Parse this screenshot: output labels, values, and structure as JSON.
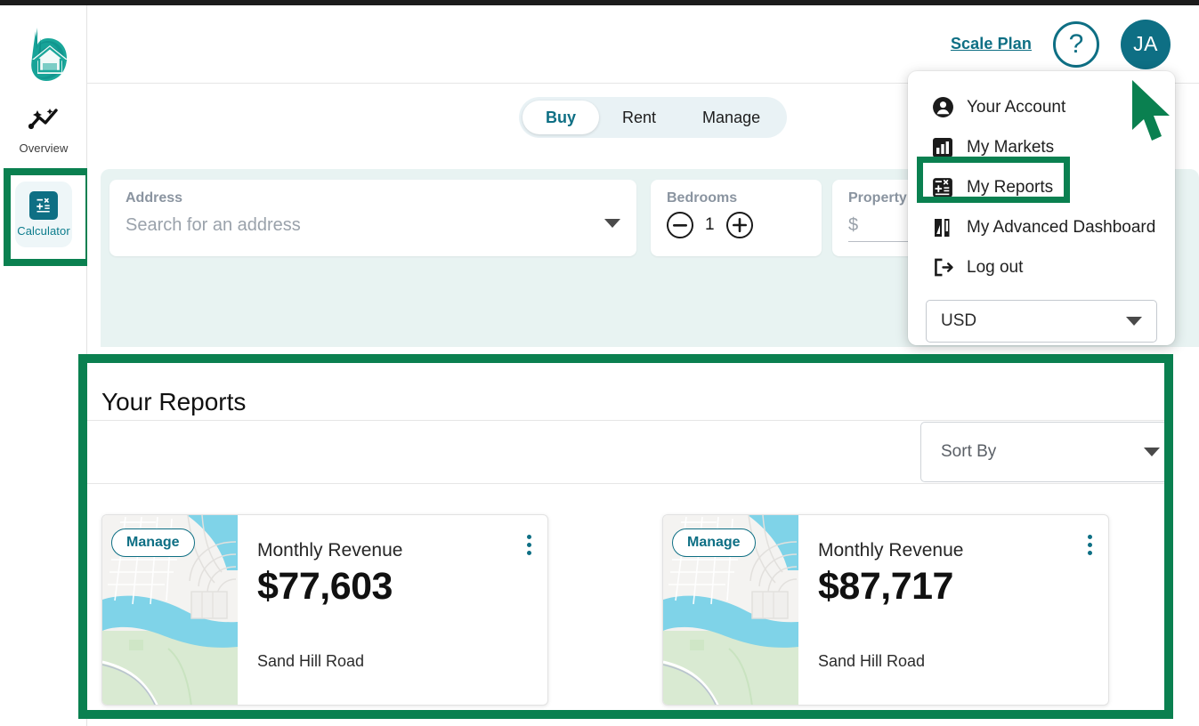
{
  "app": {
    "logo_alt": "property-logo",
    "accent_teal": "#0e6f84",
    "highlight_green": "#0a8050"
  },
  "sidebar": {
    "items": [
      {
        "label": "Overview",
        "icon": "trend-sparkle-icon",
        "active": false
      },
      {
        "label": "Calculator",
        "icon": "calculator-icon",
        "active": true
      }
    ]
  },
  "header": {
    "plan_link": "Scale Plan",
    "help_label": "?",
    "avatar_initials": "JA"
  },
  "tabs": {
    "items": [
      {
        "label": "Buy",
        "active": true
      },
      {
        "label": "Rent",
        "active": false
      },
      {
        "label": "Manage",
        "active": false
      }
    ]
  },
  "filters": {
    "address": {
      "label": "Address",
      "placeholder": "Search for an address"
    },
    "bedrooms": {
      "label": "Bedrooms",
      "value": "1",
      "minus": "−",
      "plus": "+"
    },
    "price": {
      "label": "Property P",
      "value": "$"
    }
  },
  "account_menu": {
    "items": [
      {
        "label": "Your Account",
        "icon": "person-circle-icon",
        "highlighted": false
      },
      {
        "label": "My Markets",
        "icon": "bar-chart-icon",
        "highlighted": false
      },
      {
        "label": "My Reports",
        "icon": "calculator-icon",
        "highlighted": true
      },
      {
        "label": "My Advanced Dashboard",
        "icon": "dashboard-icon",
        "highlighted": false
      },
      {
        "label": "Log out",
        "icon": "logout-icon",
        "highlighted": false
      }
    ],
    "currency": {
      "value": "USD"
    }
  },
  "reports": {
    "title": "Your Reports",
    "sort_by": {
      "placeholder": "Sort By"
    },
    "cards": [
      {
        "badge": "Manage",
        "metric_label": "Monthly Revenue",
        "amount": "$77,603",
        "address": "Sand Hill Road",
        "menu_icon": "kebab-menu-icon"
      },
      {
        "badge": "Manage",
        "metric_label": "Monthly Revenue",
        "amount": "$87,717",
        "address": "Sand Hill Road",
        "menu_icon": "kebab-menu-icon"
      }
    ]
  }
}
